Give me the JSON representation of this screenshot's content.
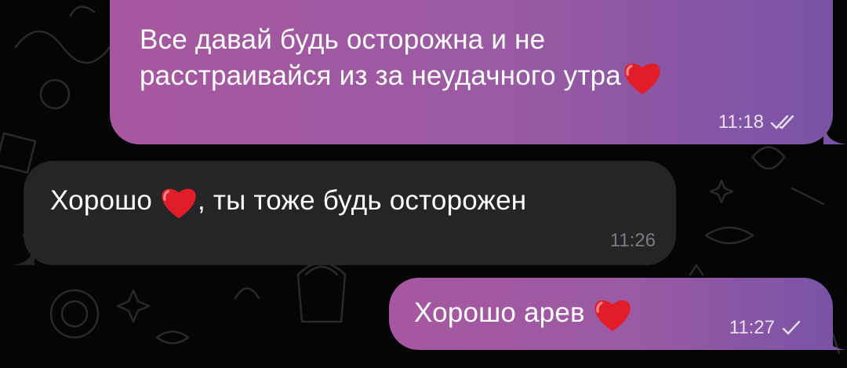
{
  "chat": {
    "messages": [
      {
        "direction": "outgoing",
        "line1": "Все давай будь осторожна и не",
        "line2": "расстраивайся из за неудачного утра",
        "emoji": "heart",
        "time": "11:18",
        "status_icon": "double-check-icon"
      },
      {
        "direction": "incoming",
        "text_before": "Хорошо",
        "emoji": "heart",
        "text_after": ", ты тоже будь осторожен",
        "time": "11:26"
      },
      {
        "direction": "outgoing",
        "text": "Хорошо арев",
        "emoji": "heart",
        "time": "11:27",
        "status_icon": "check-icon"
      }
    ]
  },
  "colors": {
    "background": "#050505",
    "outgoing_gradient_start": "#a7579f",
    "outgoing_gradient_end": "#7a53a6",
    "incoming_bubble": "#252527",
    "heart": "#e11d2a"
  }
}
